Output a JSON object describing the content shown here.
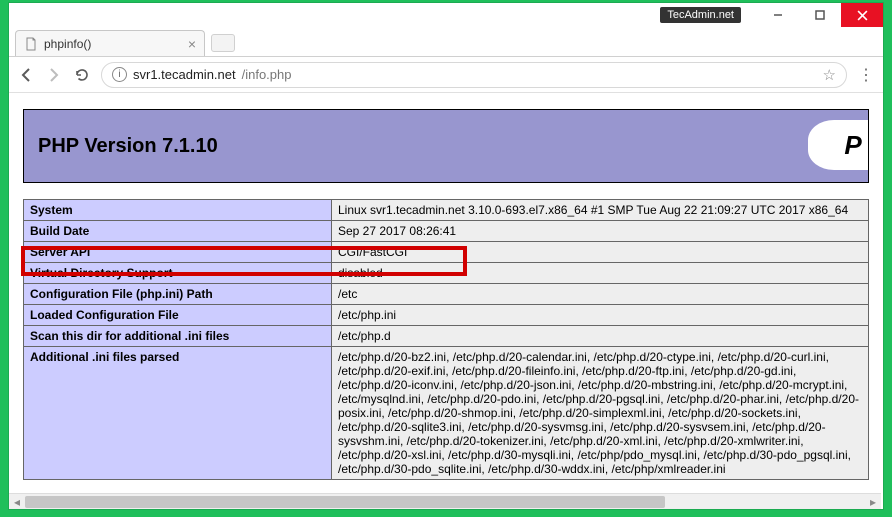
{
  "window": {
    "badge": "TecAdmin.net"
  },
  "tab": {
    "title": "phpinfo()"
  },
  "address": {
    "url_host": "svr1.tecadmin.net",
    "url_path": "/info.php"
  },
  "php": {
    "header": "PHP Version 7.1.10",
    "logo": "P"
  },
  "rows": [
    {
      "k": "System",
      "v": "Linux svr1.tecadmin.net 3.10.0-693.el7.x86_64 #1 SMP Tue Aug 22 21:09:27 UTC 2017 x86_64"
    },
    {
      "k": "Build Date",
      "v": "Sep 27 2017 08:26:41"
    },
    {
      "k": "Server API",
      "v": "CGI/FastCGI"
    },
    {
      "k": "Virtual Directory Support",
      "v": "disabled"
    },
    {
      "k": "Configuration File (php.ini) Path",
      "v": "/etc"
    },
    {
      "k": "Loaded Configuration File",
      "v": "/etc/php.ini"
    },
    {
      "k": "Scan this dir for additional .ini files",
      "v": "/etc/php.d"
    },
    {
      "k": "Additional .ini files parsed",
      "v": "/etc/php.d/20-bz2.ini, /etc/php.d/20-calendar.ini, /etc/php.d/20-ctype.ini, /etc/php.d/20-curl.ini, /etc/php.d/20-exif.ini, /etc/php.d/20-fileinfo.ini, /etc/php.d/20-ftp.ini, /etc/php.d/20-gd.ini, /etc/php.d/20-iconv.ini, /etc/php.d/20-json.ini, /etc/php.d/20-mbstring.ini, /etc/php.d/20-mcrypt.ini, /etc/mysqlnd.ini, /etc/php.d/20-pdo.ini, /etc/php.d/20-pgsql.ini, /etc/php.d/20-phar.ini, /etc/php.d/20-posix.ini, /etc/php.d/20-shmop.ini, /etc/php.d/20-simplexml.ini, /etc/php.d/20-sockets.ini, /etc/php.d/20-sqlite3.ini, /etc/php.d/20-sysvmsg.ini, /etc/php.d/20-sysvsem.ini, /etc/php.d/20-sysvshm.ini, /etc/php.d/20-tokenizer.ini, /etc/php.d/20-xml.ini, /etc/php.d/20-xmlwriter.ini, /etc/php.d/20-xsl.ini, /etc/php.d/30-mysqli.ini, /etc/php/pdo_mysql.ini, /etc/php.d/30-pdo_pgsql.ini, /etc/php.d/30-pdo_sqlite.ini, /etc/php.d/30-wddx.ini, /etc/php/xmlreader.ini"
    }
  ]
}
